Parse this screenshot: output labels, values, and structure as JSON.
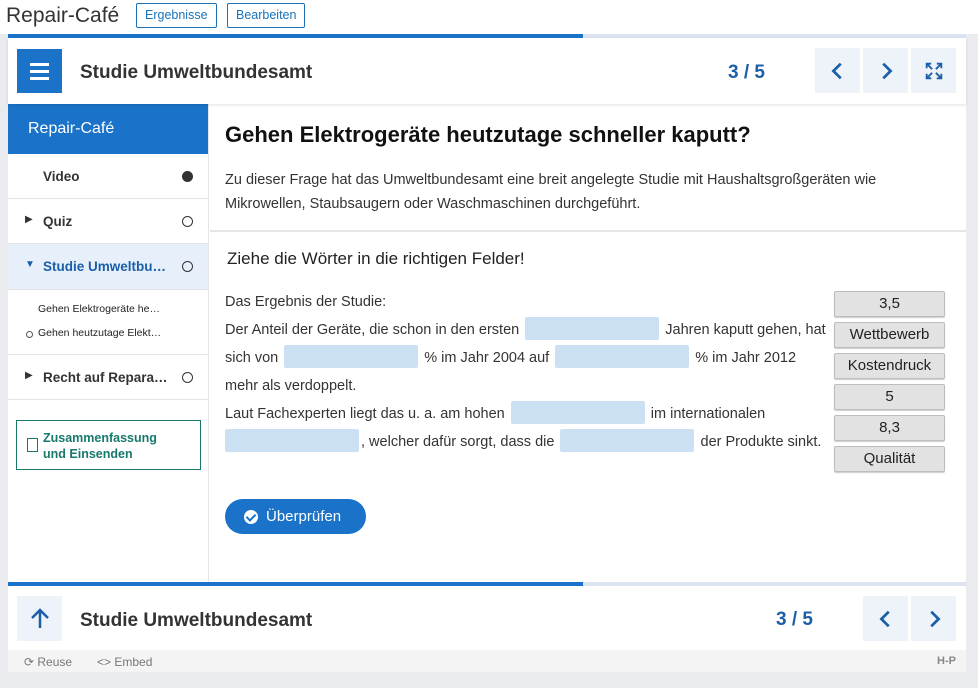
{
  "app": {
    "title": "Repair-Café",
    "results_label": "Ergebnisse",
    "edit_label": "Bearbeiten"
  },
  "progress": {
    "fraction": 0.6
  },
  "header": {
    "title": "Studie Umweltbundesamt",
    "counter": "3 / 5"
  },
  "sidebar": {
    "title": "Repair-Café",
    "items": [
      {
        "label": "Video",
        "status": "done"
      },
      {
        "label": "Quiz",
        "status": "open"
      },
      {
        "label": "Studie Umweltbu…",
        "status": "open"
      },
      {
        "label": "Recht auf Repara…",
        "status": "open"
      }
    ],
    "subitems": [
      "Gehen Elektrogeräte he…",
      "Gehen heutzutage Elekt…"
    ],
    "summary_line1": "Zusammenfassung",
    "summary_line2": "und Einsenden"
  },
  "content": {
    "title": "Gehen Elektrogeräte heutzutage schneller kaputt?",
    "intro": "Zu dieser Frage hat das Umweltbundesamt eine breit angelegte Studie mit Haushaltsgroßgeräten wie Mikrowellen, Staubsaugern oder Waschmaschinen durchgeführt.",
    "task": "Ziehe die Wörter in die richtigen Felder!",
    "cloze": {
      "heading": "Das Ergebnis der Studie:",
      "t1": "Der Anteil der Geräte, die schon in den ersten",
      "t2": "Jahren kaputt gehen, hat sich von",
      "t3": "% im Jahr 2004 auf",
      "t4": "% im Jahr 2012 mehr als verdoppelt.",
      "t5": "Laut Fachexperten liegt das u. a. am hohen",
      "t6": "im internationalen",
      "t7": ", welcher dafür sorgt, dass die",
      "t8": "der Produkte sinkt."
    },
    "words": [
      "3,5",
      "Wettbewerb",
      "Kostendruck",
      "5",
      "8,3",
      "Qualität"
    ],
    "check_label": "Überprüfen"
  },
  "footer": {
    "title": "Studie Umweltbundesamt",
    "counter": "3 / 5",
    "reuse_label": "Reuse",
    "embed_label": "Embed",
    "h5p_label": "H-P"
  },
  "colors": {
    "accent": "#1a73c8",
    "gap": "#cce0f4",
    "summary": "#17796c"
  }
}
